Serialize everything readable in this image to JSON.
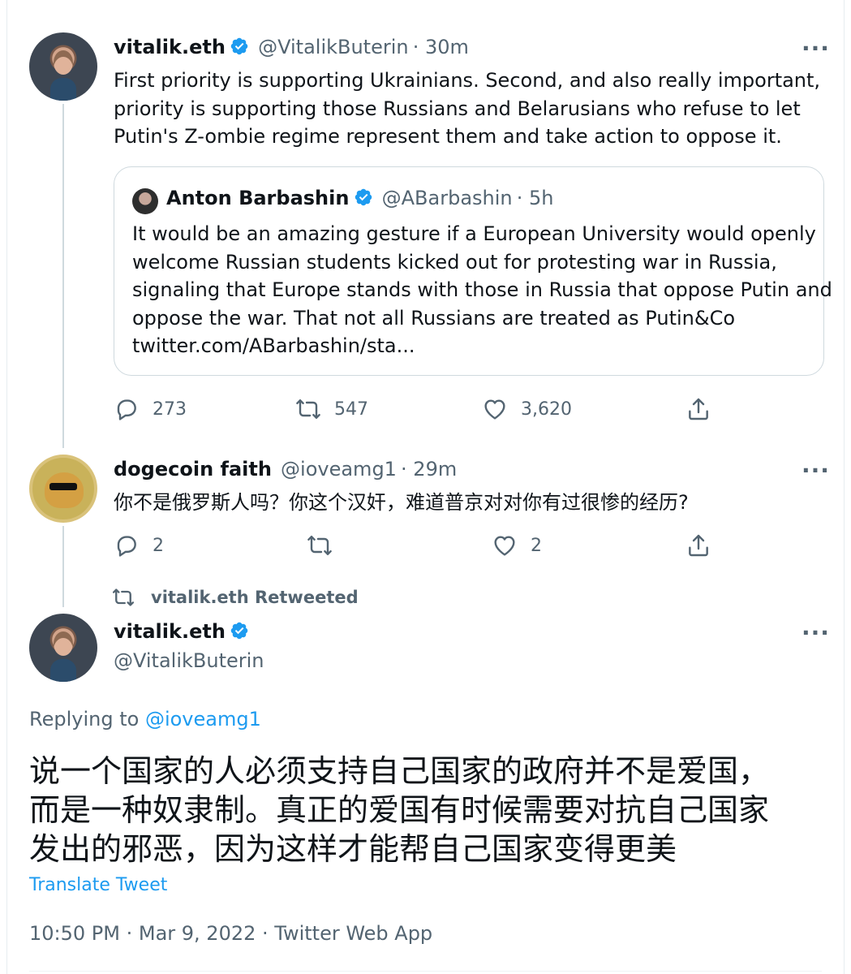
{
  "tweet1": {
    "name": "vitalik.eth",
    "handle": "@VitalikButerin",
    "time": "· 30m",
    "lines": [
      "First priority is supporting Ukrainians. Second, and also really important,",
      "priority is supporting those Russians and Belarusians who refuse to let",
      "Putin's Z-ombie regime represent them and take action to oppose it."
    ],
    "quote": {
      "name": "Anton Barbashin",
      "handle": "@ABarbashin",
      "time": "· 5h",
      "lines": [
        "It would be an amazing gesture if a European University would openly",
        "welcome Russian students kicked out for protesting war in Russia,",
        "signaling that Europe stands with those in Russia that oppose Putin and",
        "oppose the war. That not all Russians are treated as Putin&Co",
        "twitter.com/ABarbashin/sta..."
      ]
    },
    "replies": "273",
    "retweets": "547",
    "likes": "3,620"
  },
  "tweet2": {
    "name": "dogecoin faith",
    "handle": "@ioveamg1",
    "time": "· 29m",
    "text": "你不是俄罗斯人吗？你这个汉奸，难道普京对对你有过很惨的经历?",
    "replies": "2",
    "likes": "2"
  },
  "retweet_banner": "vitalik.eth Retweeted",
  "tweet3": {
    "name": "vitalik.eth",
    "handle": "@VitalikButerin",
    "replying_prefix": "Replying to",
    "replying_to": "@ioveamg1",
    "lines": [
      "说一个国家的人必须支持自己国家的政府并不是爱国，",
      "而是一种奴隶制。真正的爱国有时候需要对抗自己国家",
      "发出的邪恶，因为这样才能帮自己国家变得更美"
    ],
    "translate": "Translate Tweet",
    "timestamp": "10:50 PM · Mar 9, 2022 · Twitter Web App"
  },
  "colors": {
    "accent": "#1d9bf0",
    "secondary_text": "#536471",
    "border": "#cfd9de"
  },
  "icons": {
    "more": "more-horizontal-icon",
    "reply": "reply-icon",
    "retweet": "retweet-icon",
    "like": "heart-icon",
    "share": "share-icon",
    "verified": "verified-badge-icon"
  }
}
